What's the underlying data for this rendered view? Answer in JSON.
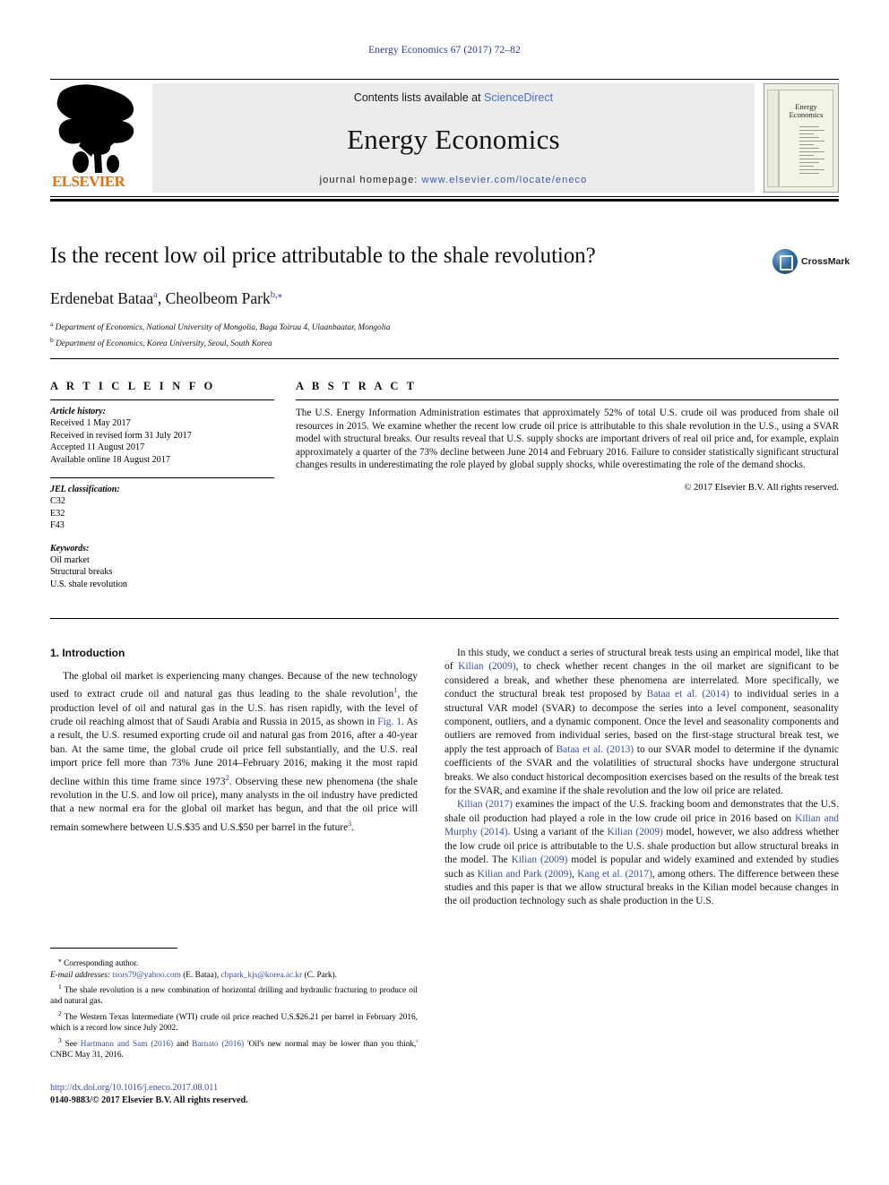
{
  "running_head": "Energy Economics 67 (2017) 72–82",
  "masthead": {
    "contents_prefix": "Contents lists available at ",
    "sciencedirect": "ScienceDirect",
    "journal_title": "Energy Economics",
    "homepage_prefix": "journal homepage: ",
    "homepage_url": "www.elsevier.com/locate/eneco",
    "publisher": "ELSEVIER",
    "cover_title_line1": "Energy",
    "cover_title_line2": "Economics"
  },
  "article": {
    "title": "Is the recent low oil price attributable to the shale revolution?",
    "authors": "Erdenebat Bataa",
    "author1": "Erdenebat Bataa",
    "author1_sup": "a",
    "author2": "Cheolbeom Park",
    "author2_sup": "b,⁎",
    "affiliation_a_marker": "a",
    "affiliation_a": "Department of Economics, National University of Mongolia, Baga Toiruu 4, Ulaanbaatar, Mongolia",
    "affiliation_b_marker": "b",
    "affiliation_b": "Department of Economics, Korea University, Seoul, South Korea",
    "crossmark_label": "CrossMark"
  },
  "article_info": {
    "heading": "A R T I C L E   I N F O",
    "history_label": "Article history:",
    "history": [
      "Received 1 May 2017",
      "Received in revised form 31 July 2017",
      "Accepted 11 August 2017",
      "Available online 18 August 2017"
    ],
    "jel_label": "JEL classification:",
    "jel_codes": [
      "C32",
      "E32",
      "F43"
    ],
    "keywords_label": "Keywords:",
    "keywords": [
      "Oil market",
      "Structural breaks",
      "U.S. shale revolution"
    ]
  },
  "abstract": {
    "heading": "A B S T R A C T",
    "text": "The U.S. Energy Information Administration estimates that approximately 52% of total U.S. crude oil was produced from shale oil resources in 2015. We examine whether the recent low crude oil price is attributable to this shale revolution in the U.S., using a SVAR model with structural breaks. Our results reveal that U.S. supply shocks are important drivers of real oil price and, for example, explain approximately a quarter of the 73% decline between June 2014 and February 2016. Failure to consider statistically significant structural changes results in underestimating the role played by global supply shocks, while overestimating the role of the demand shocks.",
    "copyright": "© 2017 Elsevier B.V. All rights reserved."
  },
  "body": {
    "section_title": "1.  Introduction",
    "left_paragraph_1_part1": "The global oil market is experiencing many changes. Because of the new technology used to extract crude oil and natural gas thus leading to the shale revolution",
    "left_paragraph_1_fn1": "1",
    "left_paragraph_1_part2": ", the production level of oil and natural gas in the U.S. has risen rapidly, with the level of crude oil reaching almost that of Saudi Arabia and Russia in 2015, as shown in ",
    "left_ref_fig1": "Fig. 1",
    "left_paragraph_1_part3": ". As a result, the U.S. resumed exporting crude oil and natural gas from 2016, after a 40-year ban. At the same time, the global crude oil price fell substantially, and the U.S. real import price fell more than 73% June 2014–February 2016, making it the most rapid decline within this time frame since 1973",
    "left_paragraph_1_fn2": "2",
    "left_paragraph_1_part4": ". Observing these new phenomena (the shale revolution in the U.S. and low oil price), many analysts in the oil industry have predicted that a new normal era for the global oil market has begun, and that the oil price will remain somewhere between U.S.$35 and U.S.$50 per barrel in the future",
    "left_paragraph_1_fn3": "3",
    "left_paragraph_1_part5": ".",
    "right_paragraph_1_part1": "In this study, we conduct a series of structural break tests using an empirical model, like that of ",
    "right_ref_kilian2009a": "Kilian (2009)",
    "right_paragraph_1_part2": ", to check whether recent changes in the oil market are significant to be considered a break, and whether these phenomena are interrelated. More specifically, we conduct the structural break test proposed by ",
    "right_ref_bataa2014": "Bataa et al. (2014)",
    "right_paragraph_1_part3": " to individual series in a structural VAR model (SVAR) to decompose the series into a level component, seasonality component, outliers, and a dynamic component. Once the level and seasonality components and outliers are removed from individual series, based on the first-stage structural break test, we apply the test approach of ",
    "right_ref_bataa2013": "Bataa et al. (2013)",
    "right_paragraph_1_part4": " to our SVAR model to determine if the dynamic coefficients of the SVAR and the volatilities of structural shocks have undergone structural breaks. We also conduct historical decomposition exercises based on the results of the break test for the SVAR, and examine if the shale revolution and the low oil price are related.",
    "right_ref_kilian2017": "Kilian (2017)",
    "right_paragraph_2_part1": " examines the impact of the U.S. fracking boom and demonstrates that the U.S. shale oil production had played a role in the low crude oil price in 2016 based on ",
    "right_ref_kilian_murphy": "Kilian and Murphy (2014)",
    "right_paragraph_2_part2": ". Using a variant of the ",
    "right_ref_kilian2009b": "Kilian (2009)",
    "right_paragraph_2_part3": " model, however, we also address whether the low crude oil price is attributable to the U.S. shale production but allow structural breaks in the model. The ",
    "right_ref_kilian2009c": "Kilian (2009)",
    "right_paragraph_2_part4": " model is popular and widely examined and extended by studies such as ",
    "right_ref_kilian_park": "Kilian and Park (2009)",
    "right_paragraph_2_part5": ", ",
    "right_ref_kang": "Kang et al. (2017)",
    "right_paragraph_2_part6": ", among others. The difference between these studies and this paper is that we allow structural breaks in the Kilian model because changes in the oil production technology such as shale production in the U.S."
  },
  "footnotes": {
    "corresponding_marker": "⁎",
    "corresponding_text": "Corresponding author.",
    "email_label": "E-mail addresses:",
    "email1": "tsors79@yahoo.com",
    "email1_owner": "(E. Bataa)",
    "email2": "cbpark_kjs@korea.ac.kr",
    "email2_owner": "(C. Park).",
    "fn1_marker": "1",
    "fn1_text": "The shale revolution is a new combination of horizontal drilling and hydraulic fracturing to produce oil and natural gas.",
    "fn2_marker": "2",
    "fn2_text": "The Western Texas Intermediate (WTI) crude oil price reached U.S.$26.21 per barrel in February 2016, which is a record low since July 2002.",
    "fn3_marker": "3",
    "fn3_prefix": "See ",
    "fn3_ref1": "Hartmann and Sam (2016)",
    "fn3_mid": " and ",
    "fn3_ref2": "Barnato (2016)",
    "fn3_suffix": " 'Oil's new normal may be lower than you think,' CNBC May 31, 2016."
  },
  "page_footer": {
    "doi": "http://dx.doi.org/10.1016/j.eneco.2017.08.011",
    "issn_line": "0140-9883/© 2017 Elsevier B.V. All rights reserved."
  }
}
